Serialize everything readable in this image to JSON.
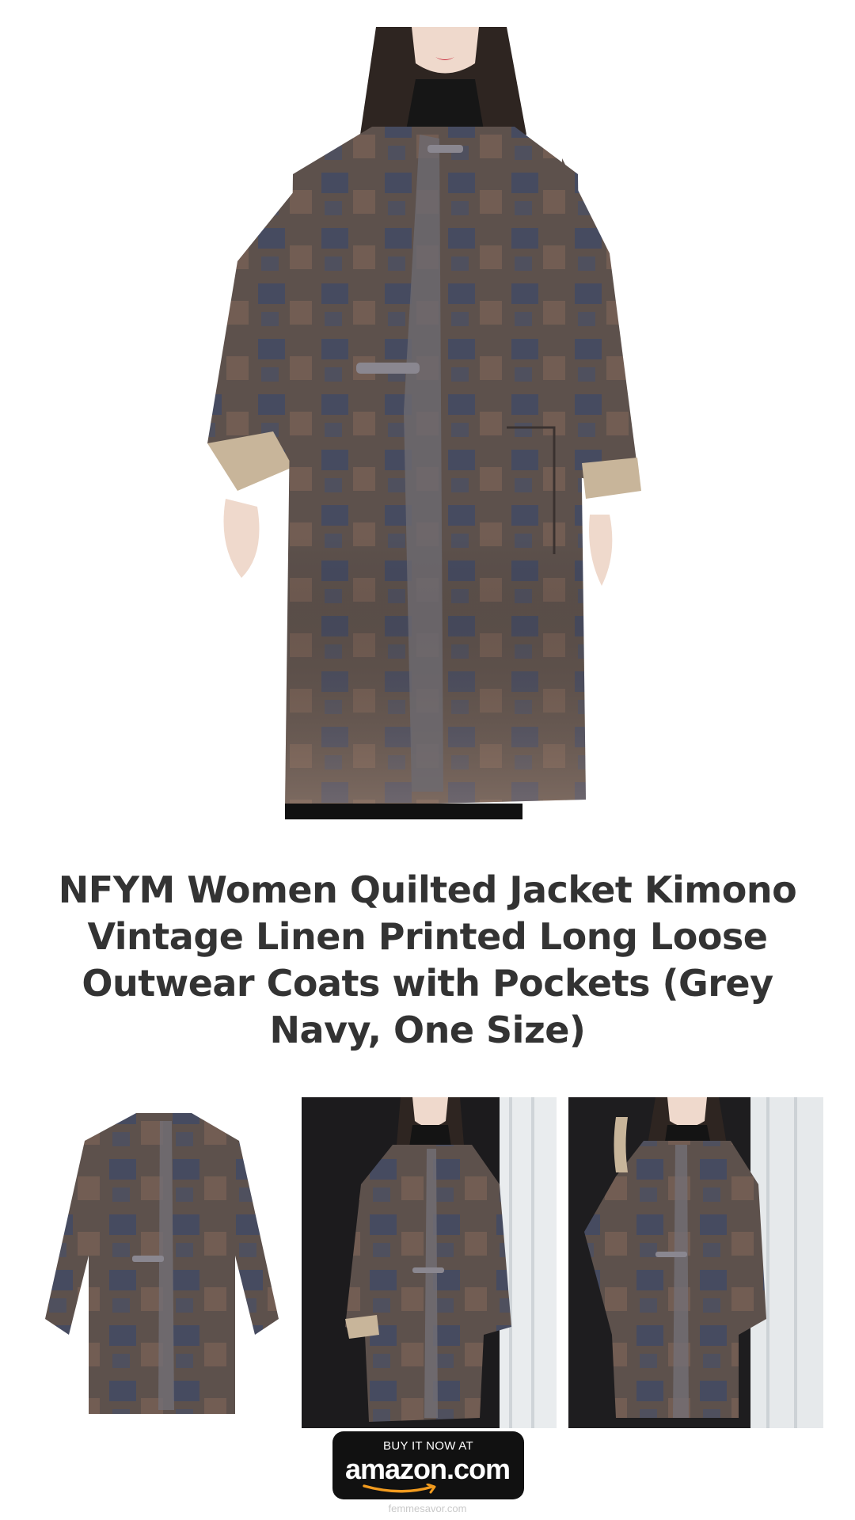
{
  "product": {
    "title": "NFYM Women Quilted Jacket Kimono Vintage Linen Printed Long Loose Outwear Coats with Pockets (Grey Navy, One Size)"
  },
  "images": {
    "hero": "coat-model-front",
    "thumbnails": [
      "coat-flat-lay",
      "coat-model-side",
      "coat-model-pocket"
    ]
  },
  "cta": {
    "top_text": "BUY IT NOW AT",
    "brand_text": "amazon.com"
  },
  "footer": {
    "site": "femmesavor.com"
  },
  "colors": {
    "title_text": "#333333",
    "coat_base": "#5b4f4a",
    "coat_navy": "#3c4763",
    "button_bg": "#111111",
    "amazon_orange": "#f29b1e"
  }
}
